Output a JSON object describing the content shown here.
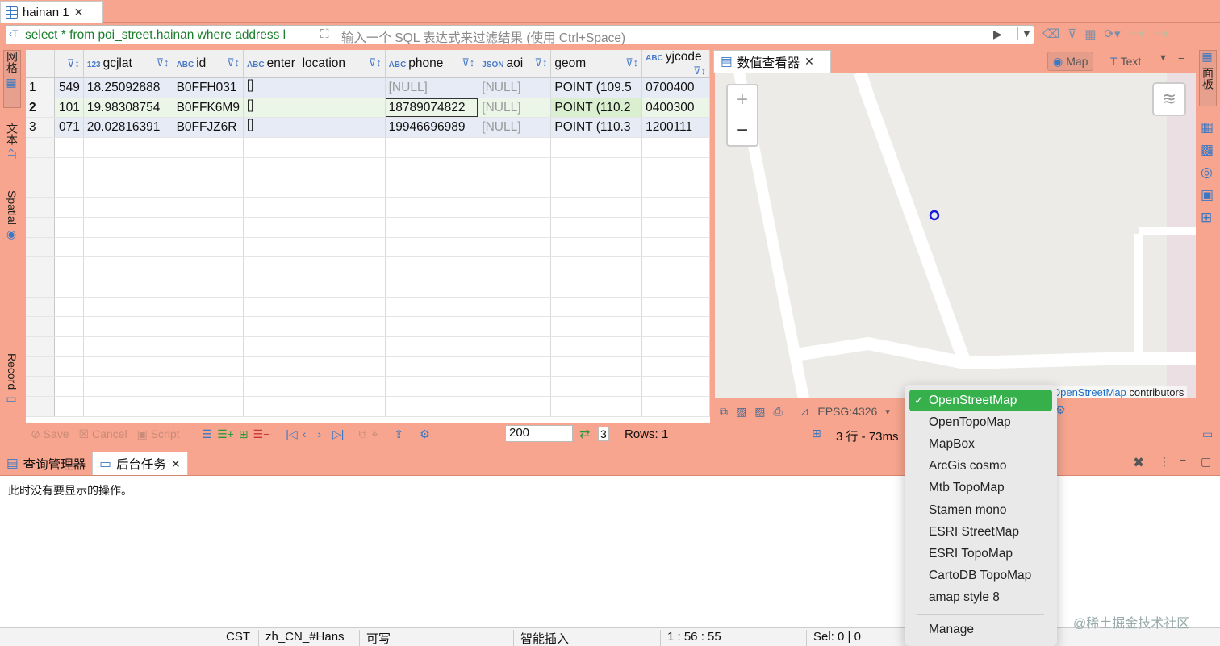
{
  "editor_tab": {
    "title": "hainan 1"
  },
  "sql_bar": {
    "query": "select * from poi_street.hainan where address l",
    "filter_placeholder": "输入一个 SQL 表达式来过滤结果 (使用 Ctrl+Space)"
  },
  "left_tabs": [
    "网格",
    "文本",
    "Spatial",
    "Record"
  ],
  "grid": {
    "columns": [
      {
        "type": "",
        "name": ""
      },
      {
        "type": "123",
        "name": "gcjlat"
      },
      {
        "type": "ABC",
        "name": "id"
      },
      {
        "type": "ABC",
        "name": "enter_location"
      },
      {
        "type": "ABC",
        "name": "phone"
      },
      {
        "type": "JSON",
        "name": "aoi"
      },
      {
        "type": "",
        "name": "geom"
      },
      {
        "type": "ABC",
        "name": "yjcode"
      }
    ],
    "rows": [
      {
        "n": "1",
        "cells": [
          "549",
          "18.25092888",
          "B0FFH031",
          "[]",
          "[NULL]",
          "[NULL]",
          "POINT (109.5",
          "0700400"
        ]
      },
      {
        "n": "2",
        "cells": [
          "101",
          "19.98308754",
          "B0FFK6M9",
          "[]",
          "18789074822",
          "[NULL]",
          "POINT (110.2",
          "0400300"
        ]
      },
      {
        "n": "3",
        "cells": [
          "071",
          "20.02816391",
          "B0FFJZ6R",
          "[]",
          "19946696989",
          "[NULL]",
          "POINT (110.3",
          "1200111"
        ]
      }
    ]
  },
  "result_toolbar": {
    "save": "Save",
    "cancel": "Cancel",
    "script": "Script",
    "fetch_size": "200",
    "fetch_count": "3",
    "rows": "Rows: 1",
    "summary": "3 行 - 73ms"
  },
  "map_panel": {
    "tab_title": "数值查看器",
    "map_label": "Map",
    "text_label": "Text",
    "zoom_in": "+",
    "zoom_out": "−",
    "attribution_link": "OpenStreetMap",
    "attribution_rest": " contributors",
    "crs": "EPSG:4326"
  },
  "right_tabs": [
    "面板"
  ],
  "bottom_tabs": [
    {
      "label": "查询管理器"
    },
    {
      "label": "后台任务"
    }
  ],
  "bottom_message": "此时没有要显示的操作。",
  "status_bar": {
    "timezone": "CST",
    "locale": "zh_CN_#Hans",
    "mode": "可写",
    "insert": "智能插入",
    "position": "1 : 56 : 55",
    "selection": "Sel: 0 | 0"
  },
  "basemap_menu": {
    "items": [
      "OpenStreetMap",
      "OpenTopoMap",
      "MapBox",
      "ArcGis cosmo",
      "Mtb TopoMap",
      "Stamen mono",
      "ESRI StreetMap",
      "ESRI TopoMap",
      "CartoDB TopoMap",
      "amap style 8"
    ],
    "selected": "OpenStreetMap",
    "manage": "Manage"
  },
  "watermark": "@稀土掘金技术社区",
  "colors": {
    "accent_bg": "#f7a58e",
    "sql_text": "#1c7f2e",
    "menu_active": "#35b04b",
    "link": "#1d6dc4"
  }
}
